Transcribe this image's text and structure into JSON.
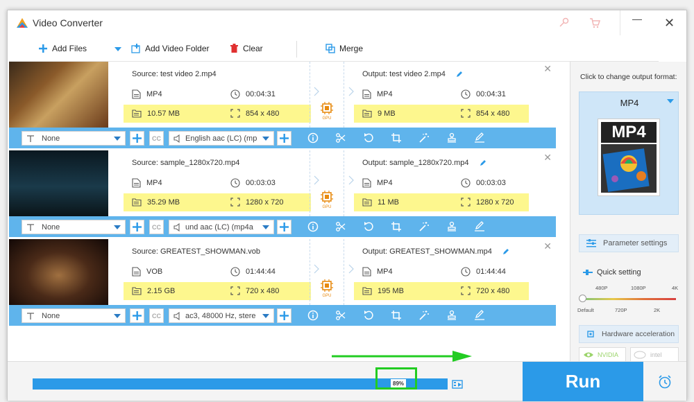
{
  "titlebar": {
    "title": "Video Converter"
  },
  "toolbar": {
    "add_files": "Add Files",
    "add_folder": "Add Video Folder",
    "clear": "Clear",
    "merge": "Merge"
  },
  "items": [
    {
      "source": "Source: test video 2.mp4",
      "output": "Output: test video 2.mp4",
      "src_format": "MP4",
      "src_duration": "00:04:31",
      "src_size": "10.57 MB",
      "src_resolution": "854 x 480",
      "out_format": "MP4",
      "out_duration": "00:04:31",
      "out_size": "9 MB",
      "out_resolution": "854 x 480",
      "subtitle": "None",
      "audio": "English aac (LC) (mp"
    },
    {
      "source": "Source: sample_1280x720.mp4",
      "output": "Output: sample_1280x720.mp4",
      "src_format": "MP4",
      "src_duration": "00:03:03",
      "src_size": "35.29 MB",
      "src_resolution": "1280 x 720",
      "out_format": "MP4",
      "out_duration": "00:03:03",
      "out_size": "11 MB",
      "out_resolution": "1280 x 720",
      "subtitle": "None",
      "audio": "und aac (LC) (mp4a"
    },
    {
      "source": "Source: GREATEST_SHOWMAN.vob",
      "output": "Output: GREATEST_SHOWMAN.mp4",
      "src_format": "VOB",
      "src_duration": "01:44:44",
      "src_size": "2.15 GB",
      "src_resolution": "720 x 480",
      "out_format": "MP4",
      "out_duration": "01:44:44",
      "out_size": "195 MB",
      "out_resolution": "720 x 480",
      "subtitle": "None",
      "audio": "ac3, 48000 Hz, stere"
    }
  ],
  "gpu_label": "GPU",
  "right": {
    "prompt": "Click to change output format:",
    "format": "MP4",
    "format_tile": "MP4",
    "param_settings": "Parameter settings",
    "quick_setting": "Quick setting",
    "ticks_top": [
      "480P",
      "1080P",
      "4K"
    ],
    "ticks_bottom": [
      "Default",
      "720P",
      "2K"
    ],
    "hw_accel": "Hardware acceleration",
    "nvidia": "NVIDIA",
    "intel": "intel"
  },
  "bottom": {
    "progress": "89%",
    "progress_value": 0.89,
    "run": "Run"
  },
  "colors": {
    "accent": "#2b9ae8",
    "bar": "#5fb4ec",
    "highlight": "#fdf78e",
    "annot": "#22cc22"
  }
}
